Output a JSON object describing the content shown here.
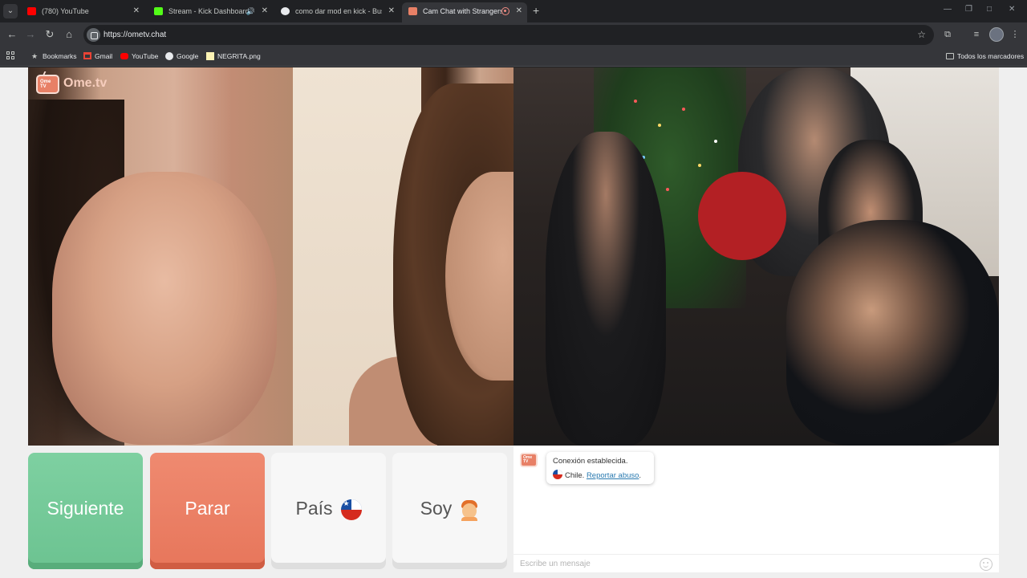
{
  "browser": {
    "tabs": [
      {
        "title": "(780) YouTube",
        "favicon": "youtube-icon",
        "active": false
      },
      {
        "title": "Stream - Kick Dashboard",
        "favicon": "kick-icon",
        "active": false,
        "audio": true
      },
      {
        "title": "como dar mod en kick - Buscar",
        "favicon": "google-icon",
        "active": false
      },
      {
        "title": "Cam Chat with Strangers on",
        "favicon": "ometv-icon",
        "active": true,
        "recording": true
      }
    ],
    "url": "https://ometv.chat",
    "bookmarks": [
      {
        "label": "Bookmarks",
        "icon": "star-icon"
      },
      {
        "label": "Gmail",
        "icon": "gmail-icon"
      },
      {
        "label": "YouTube",
        "icon": "youtube-icon"
      },
      {
        "label": "Google",
        "icon": "google-icon"
      },
      {
        "label": "NEGRITA.png",
        "icon": "image-file-icon"
      }
    ],
    "all_bookmarks": "Todos los marcadores"
  },
  "app": {
    "logo": "Ome.tv",
    "logo_badge": "Ome TV",
    "buttons": {
      "next": "Siguiente",
      "stop": "Parar",
      "country": "País",
      "gender": "Soy"
    },
    "chat": {
      "status": "Conexión establecida.",
      "country": "Chile.",
      "report": "Reportar abuso",
      "placeholder": "Escribe un mensaje"
    }
  }
}
